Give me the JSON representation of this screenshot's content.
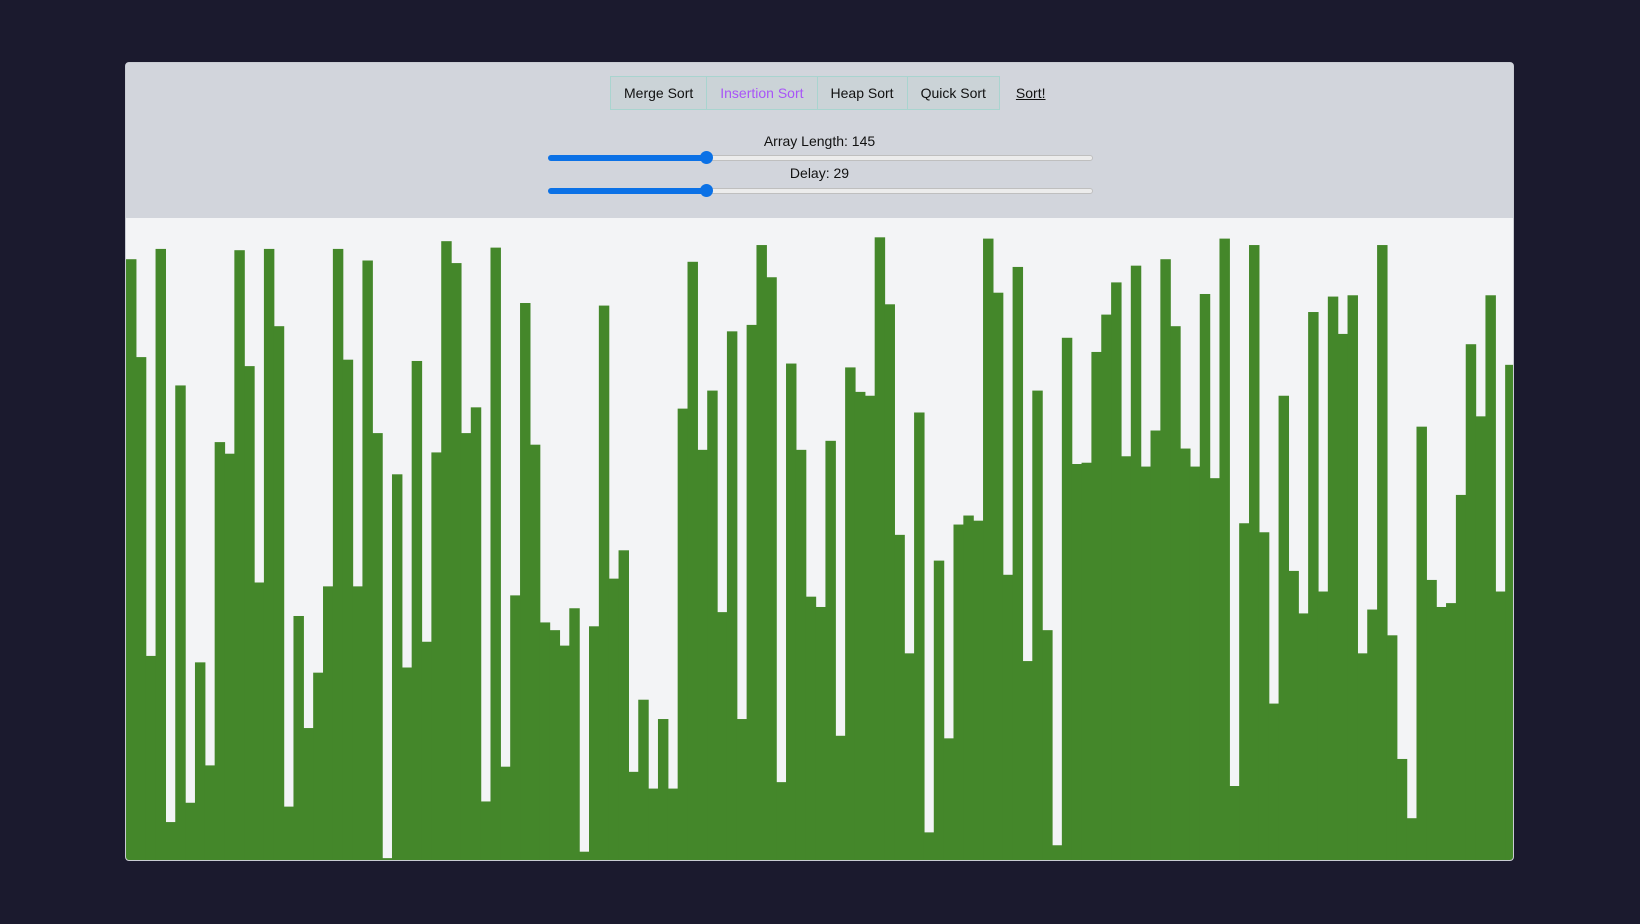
{
  "toolbar": {
    "algorithms": [
      {
        "label": "Merge Sort",
        "active": false
      },
      {
        "label": "Insertion Sort",
        "active": true
      },
      {
        "label": "Heap Sort",
        "active": false
      },
      {
        "label": "Quick Sort",
        "active": false
      }
    ],
    "sort_label": "Sort!",
    "active_color": "#a855f7"
  },
  "controls": {
    "array_length_label": "Array Length: 145",
    "array_length_value": 145,
    "array_length_fraction": 0.29,
    "delay_label": "Delay: 29",
    "delay_value": 29,
    "delay_fraction": 0.29,
    "slider_color": "#0b71e6"
  },
  "chart_data": {
    "type": "bar",
    "bar_color": "#44872a",
    "values": [
      468,
      392,
      160,
      476,
      31,
      370,
      46,
      155,
      75,
      326,
      317,
      475,
      385,
      217,
      476,
      416,
      43,
      191,
      104,
      147,
      214,
      476,
      390,
      214,
      467,
      333,
      3,
      301,
      151,
      389,
      171,
      318,
      482,
      465,
      333,
      353,
      47,
      477,
      74,
      207,
      434,
      324,
      186,
      180,
      168,
      197,
      8,
      183,
      432,
      220,
      242,
      70,
      126,
      57,
      111,
      57,
      352,
      466,
      320,
      366,
      194,
      412,
      111,
      417,
      479,
      454,
      62,
      387,
      320,
      206,
      198,
      327,
      98,
      384,
      365,
      362,
      485,
      433,
      254,
      162,
      349,
      23,
      234,
      96,
      262,
      269,
      265,
      484,
      442,
      223,
      462,
      156,
      366,
      180,
      13,
      407,
      309,
      310,
      396,
      425,
      450,
      315,
      463,
      307,
      335,
      468,
      416,
      321,
      307,
      441,
      298,
      484,
      59,
      263,
      479,
      256,
      123,
      362,
      226,
      193,
      427,
      210,
      439,
      410,
      440,
      162,
      196,
      479,
      176,
      80,
      34,
      338,
      219,
      198,
      201,
      285,
      402,
      346,
      440,
      210,
      386
    ],
    "ylim": [
      0,
      500
    ]
  }
}
